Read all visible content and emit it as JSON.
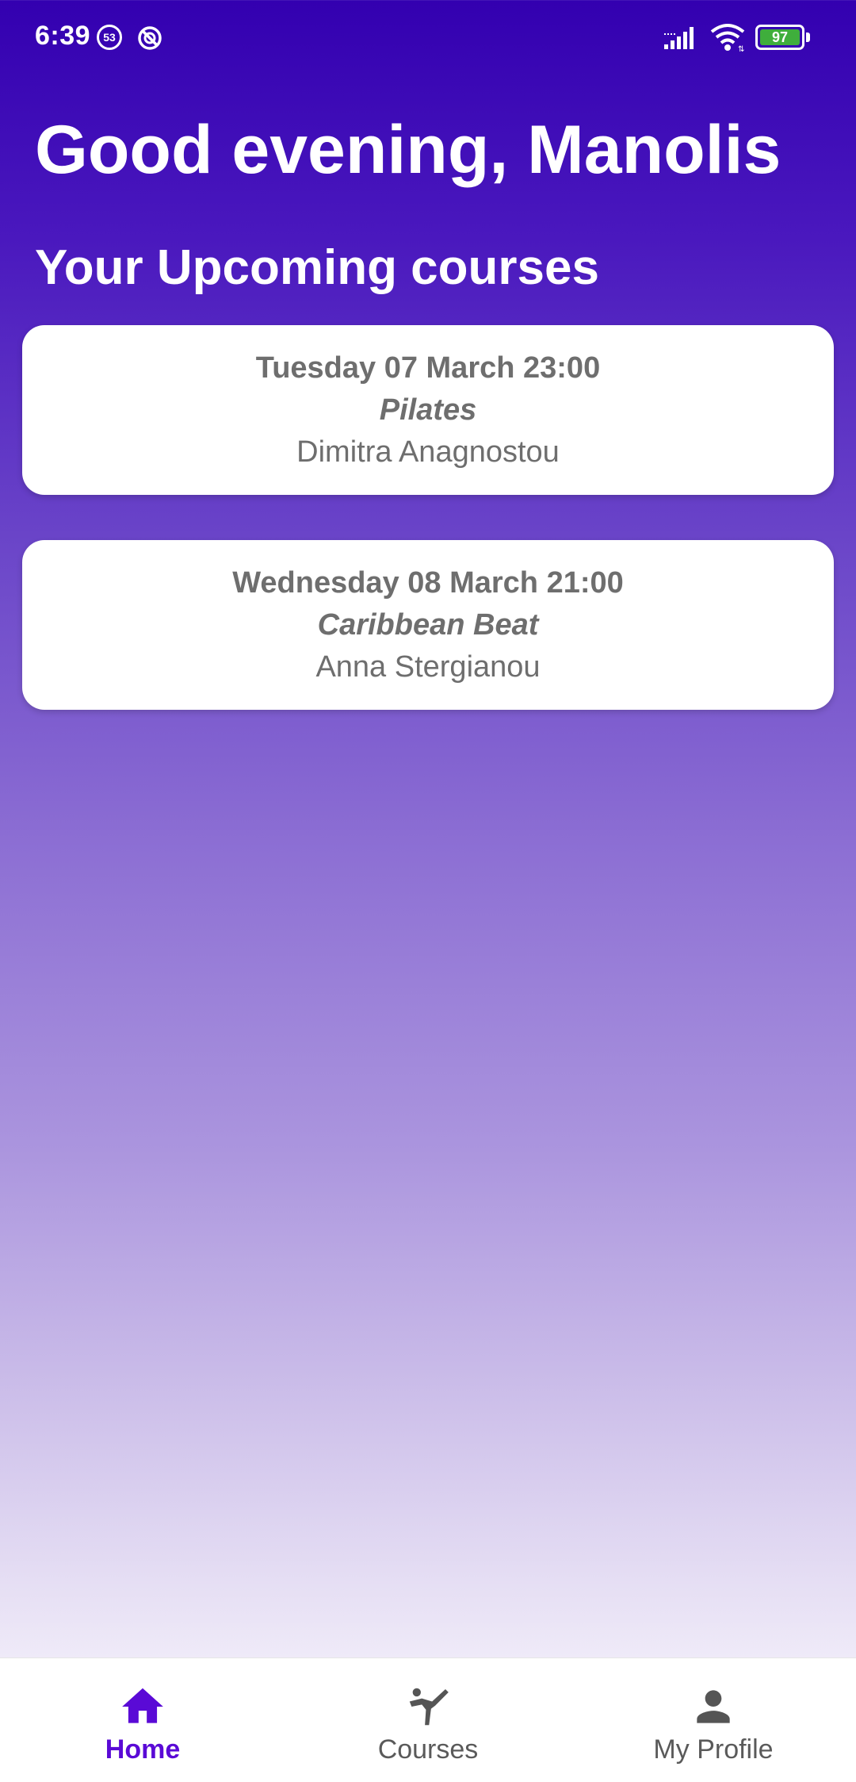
{
  "status_bar": {
    "time": "6:39",
    "notification_count": "53",
    "battery_level": "97",
    "battery_color": "#3fae3c"
  },
  "header": {
    "greeting": "Good evening, Manolis",
    "section_title": "Your Upcoming courses"
  },
  "courses": [
    {
      "datetime": "Tuesday 07 March 23:00",
      "name": "Pilates",
      "instructor": "Dimitra Anagnostou"
    },
    {
      "datetime": "Wednesday 08 March 21:00",
      "name": "Caribbean Beat",
      "instructor": "Anna Stergianou"
    }
  ],
  "bottom_nav": {
    "items": [
      {
        "label": "Home",
        "icon": "home-icon",
        "active": true
      },
      {
        "label": "Courses",
        "icon": "martial-arts-icon",
        "active": false
      },
      {
        "label": "My Profile",
        "icon": "person-icon",
        "active": false
      }
    ],
    "active_color": "#5a0ad6",
    "inactive_color": "#5a5a5a"
  },
  "theme": {
    "gradient_top": "#3300b0",
    "gradient_bottom": "#efeaf8",
    "card_text_color": "#6e6e6e"
  }
}
